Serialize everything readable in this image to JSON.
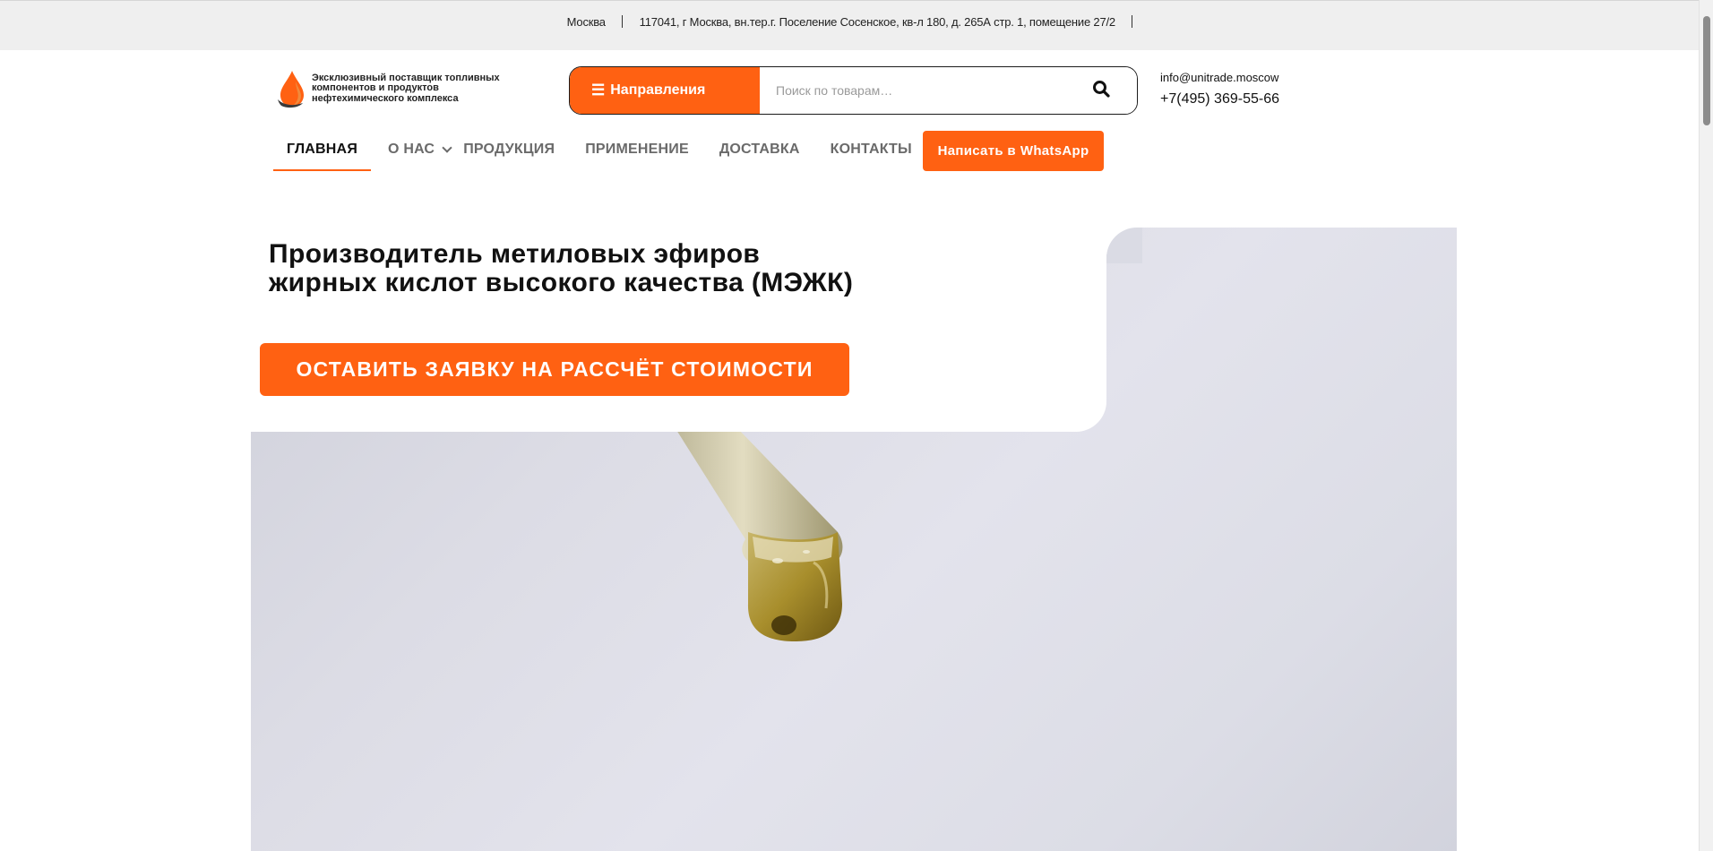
{
  "topbar": {
    "city": "Москва",
    "address": "117041, г Москва, вн.тер.г. Поселение Сосенское, кв-л 180, д. 265А стр. 1, помещение 27/2"
  },
  "logo": {
    "text": "Эксклюзивный поставщик топливных компонентов и продуктов нефтехимического комплекса",
    "icon": "oil-drop-logo-icon"
  },
  "search": {
    "directions_label": "Направления",
    "burger_icon": "menu-icon",
    "placeholder": "Поиск по товарам…",
    "search_icon": "search-icon"
  },
  "contacts": {
    "email": "info@unitrade.moscow",
    "phone": "+7(495) 369-55-66"
  },
  "nav": {
    "items": [
      {
        "label": "ГЛАВНАЯ",
        "active": true
      },
      {
        "label": "О НАС",
        "has_submenu": true
      },
      {
        "label": "ПРОДУКЦИЯ"
      },
      {
        "label": "ПРИМЕНЕНИЕ"
      },
      {
        "label": "ДОСТАВКА"
      },
      {
        "label": "КОНТАКТЫ"
      }
    ],
    "whatsapp_prefix": "Написать в",
    "whatsapp_brand": "WhatsApp"
  },
  "hero": {
    "title_line1": "Производитель метиловых эфиров",
    "title_line2": "жирных кислот высокого качества (МЭЖК)",
    "cta": "ОСТАВИТЬ ЗАЯВКУ НА РАССЧЁТ СТОИМОСТИ"
  },
  "colors": {
    "accent": "#ff6112",
    "topbar_bg": "#efefef",
    "hero_bg": "#dcdce5"
  }
}
